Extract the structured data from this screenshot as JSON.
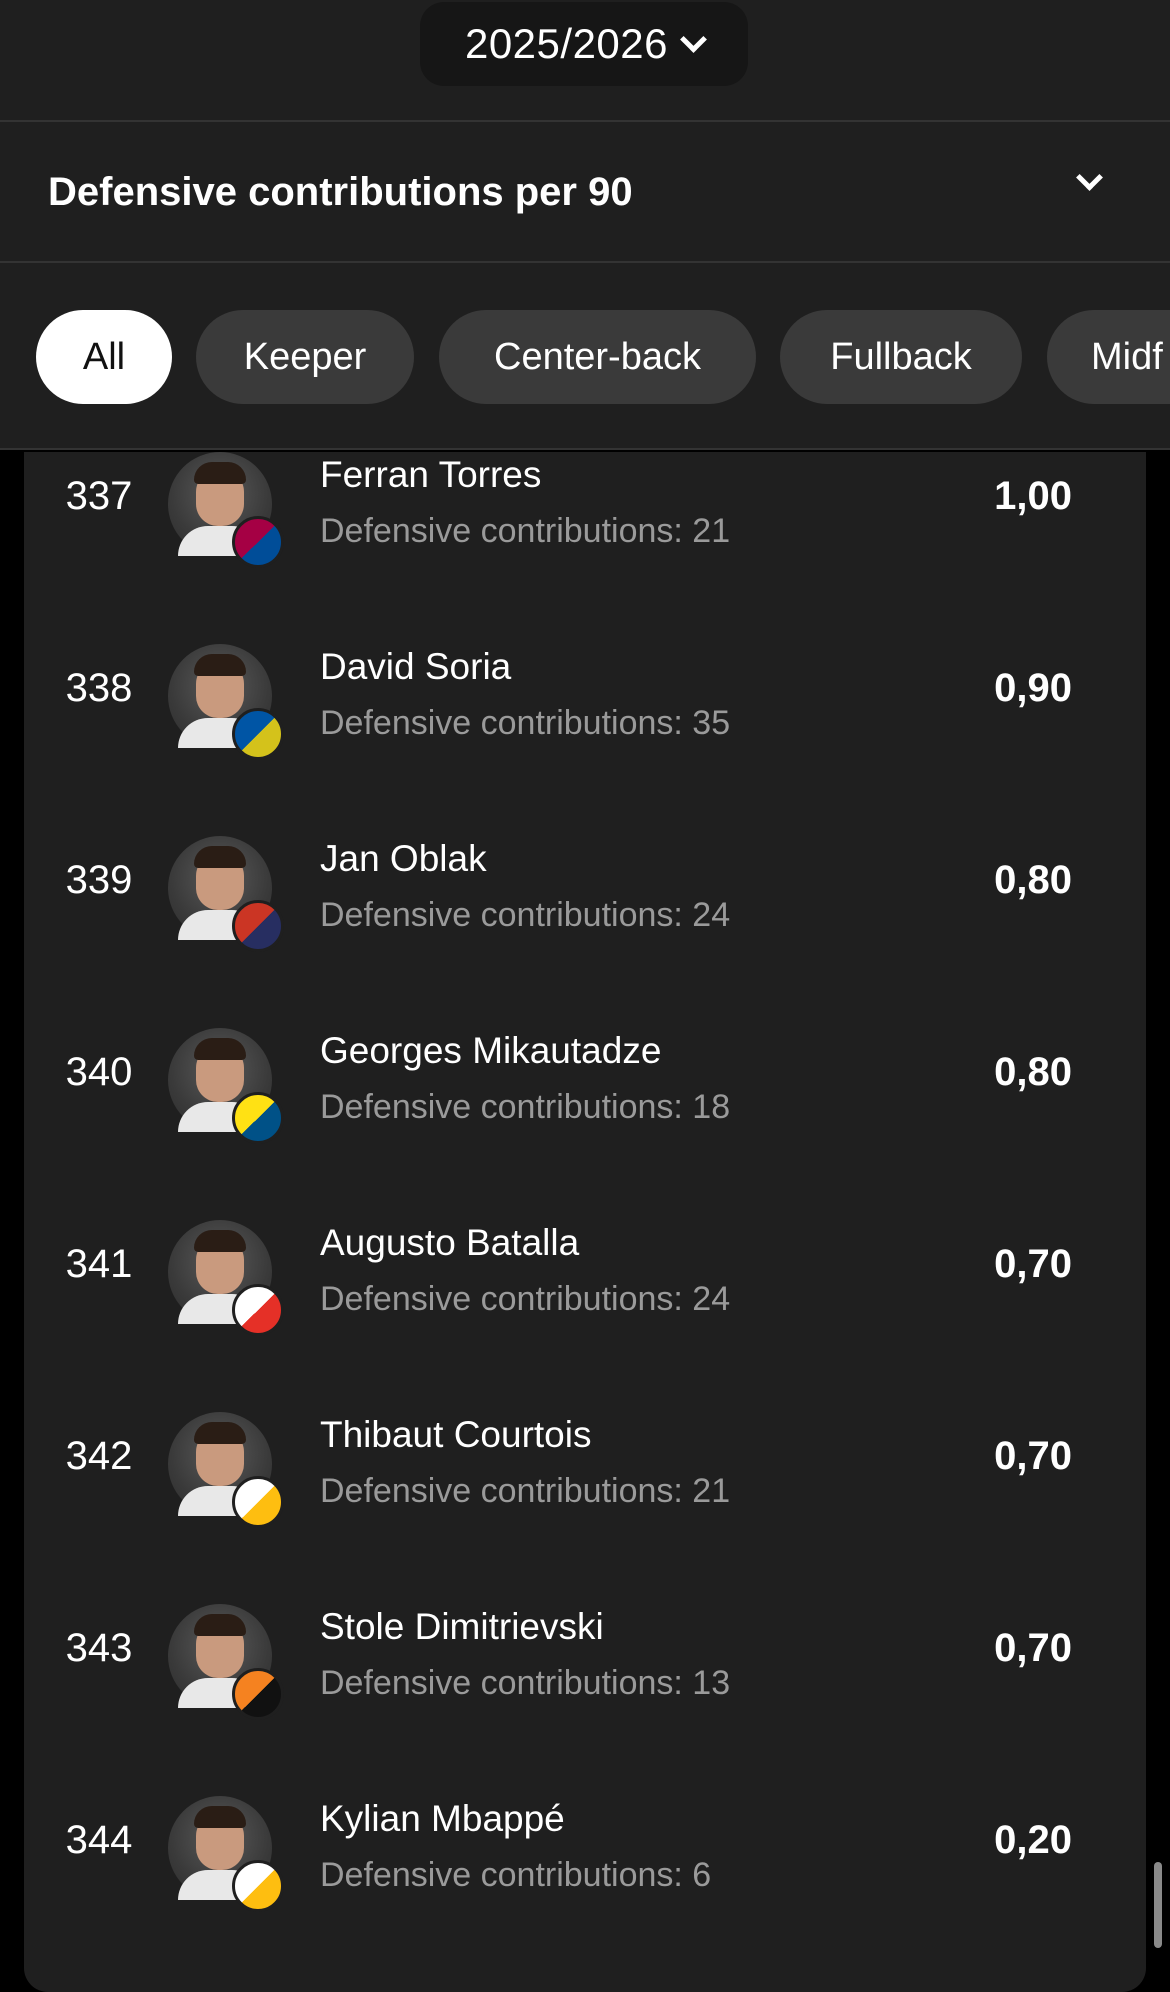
{
  "season": {
    "label": "2025/2026"
  },
  "metric": {
    "title": "Defensive contributions per 90"
  },
  "filters": [
    {
      "label": "All",
      "active": true
    },
    {
      "label": "Keeper",
      "active": false
    },
    {
      "label": "Center-back",
      "active": false
    },
    {
      "label": "Fullback",
      "active": false
    },
    {
      "label": "Midf",
      "active": false
    }
  ],
  "players": [
    {
      "rank": "337",
      "name": "Ferran Torres",
      "sub": "Defensive contributions: 21",
      "value": "1,00",
      "club_color": "#a50044",
      "club_color2": "#004d98"
    },
    {
      "rank": "338",
      "name": "David Soria",
      "sub": "Defensive contributions: 35",
      "value": "0,90",
      "club_color": "#0055a5",
      "club_color2": "#d4c21b"
    },
    {
      "rank": "339",
      "name": "Jan Oblak",
      "sub": "Defensive contributions: 24",
      "value": "0,80",
      "club_color": "#cb3524",
      "club_color2": "#272e61"
    },
    {
      "rank": "340",
      "name": "Georges Mikautadze",
      "sub": "Defensive contributions: 18",
      "value": "0,80",
      "club_color": "#ffe114",
      "club_color2": "#005187"
    },
    {
      "rank": "341",
      "name": "Augusto Batalla",
      "sub": "Defensive contributions: 24",
      "value": "0,70",
      "club_color": "#ffffff",
      "club_color2": "#e53027"
    },
    {
      "rank": "342",
      "name": "Thibaut Courtois",
      "sub": "Defensive contributions: 21",
      "value": "0,70",
      "club_color": "#ffffff",
      "club_color2": "#febe10"
    },
    {
      "rank": "343",
      "name": "Stole Dimitrievski",
      "sub": "Defensive contributions: 13",
      "value": "0,70",
      "club_color": "#f58220",
      "club_color2": "#111111"
    },
    {
      "rank": "344",
      "name": "Kylian Mbappé",
      "sub": "Defensive contributions: 6",
      "value": "0,20",
      "club_color": "#ffffff",
      "club_color2": "#febe10"
    }
  ]
}
